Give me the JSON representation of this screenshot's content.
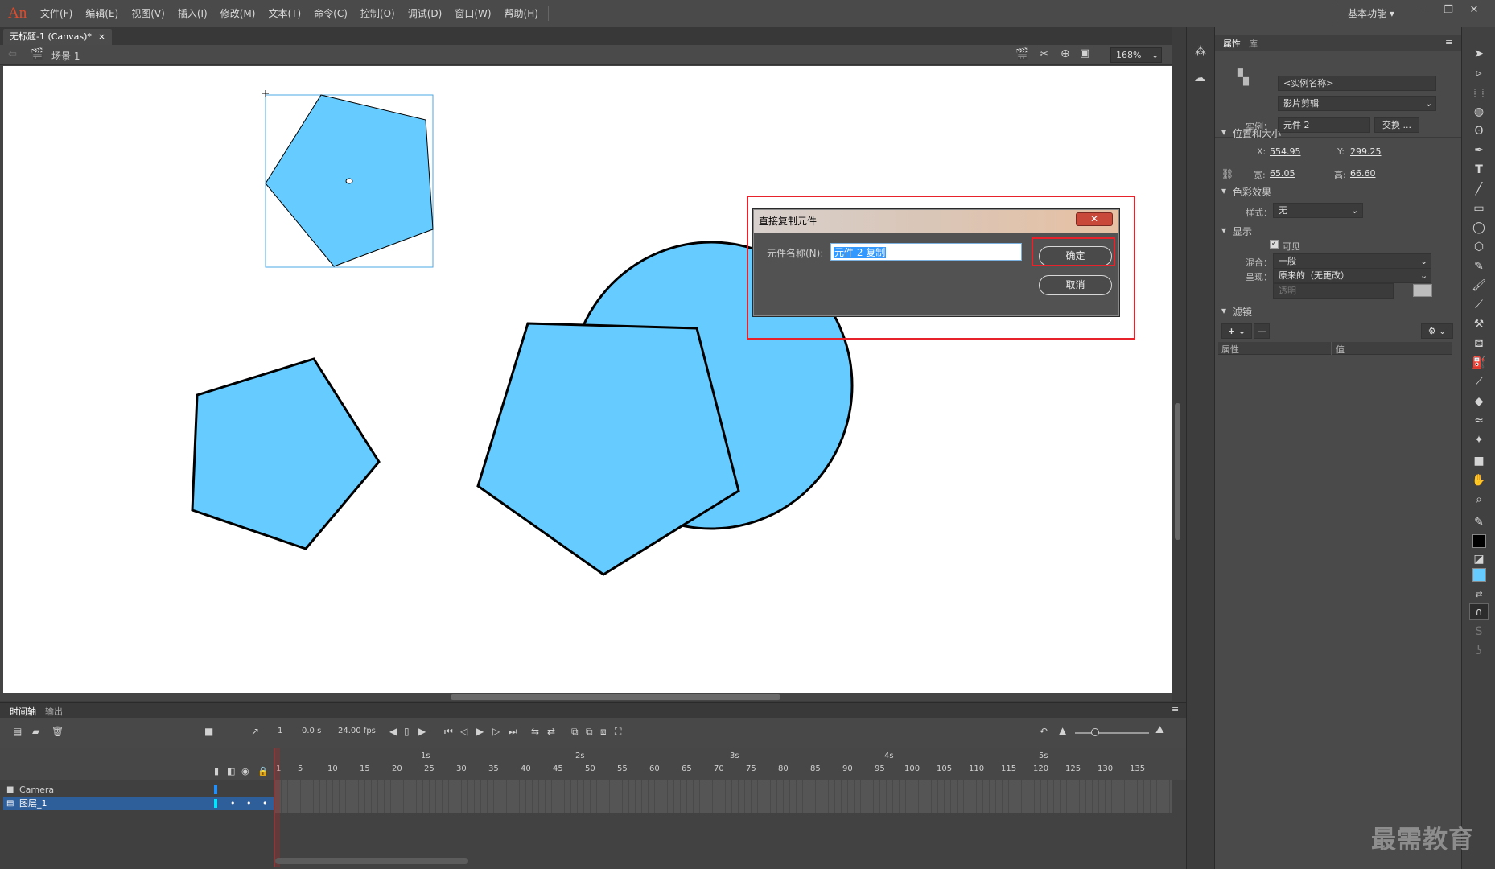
{
  "app": {
    "logo": "An",
    "workspace": "基本功能 ▾"
  },
  "menu": [
    "文件(F)",
    "编辑(E)",
    "视图(V)",
    "插入(I)",
    "修改(M)",
    "文本(T)",
    "命令(C)",
    "控制(O)",
    "调试(D)",
    "窗口(W)",
    "帮助(H)"
  ],
  "window_controls": {
    "minimize": "—",
    "restore": "❐",
    "close": "✕"
  },
  "document": {
    "tab_title": "无标题-1 (Canvas)*",
    "tab_close": "×",
    "scene": "场景 1",
    "zoom": "168%"
  },
  "dialog": {
    "title": "直接复制元件",
    "close": "✕",
    "name_label": "元件名称(N):",
    "name_value": "元件 2 复制",
    "ok_label": "确定",
    "cancel_label": "取消"
  },
  "properties": {
    "tab_properties": "属性",
    "tab_library": "库",
    "instance_name_placeholder": "<实例名称>",
    "symbol_type": "影片剪辑",
    "instance_label": "实例：",
    "instance_value": "元件 2",
    "swap_button": "交换 ...",
    "position_section": "位置和大小",
    "x_label": "X:",
    "x_value": "554.95",
    "y_label": "Y:",
    "y_value": "299.25",
    "w_label": "宽:",
    "w_value": "65.05",
    "h_label": "高:",
    "h_value": "66.60",
    "color_section": "色彩效果",
    "style_label": "样式：",
    "style_value": "无",
    "display_section": "显示",
    "visible_label": "可见",
    "blend_label": "混合：",
    "blend_value": "一般",
    "render_label": "呈现：",
    "render_value": "原来的（无更改）",
    "transparent_value": "透明",
    "filter_section": "滤镜",
    "filter_col_property": "属性",
    "filter_col_value": "值"
  },
  "timeline": {
    "tab_timeline": "时间轴",
    "tab_output": "输出",
    "current_frame": "1",
    "time": "0.0 s",
    "fps": "24.00 fps",
    "seconds": [
      "1s",
      "2s",
      "3s",
      "4s",
      "5s"
    ],
    "frame_numbers": [
      "1",
      "5",
      "10",
      "15",
      "20",
      "25",
      "30",
      "35",
      "40",
      "45",
      "50",
      "55",
      "60",
      "65",
      "70",
      "75",
      "80",
      "85",
      "90",
      "95",
      "100",
      "105",
      "110",
      "115",
      "120",
      "125",
      "130",
      "135"
    ],
    "layers": [
      {
        "name": "Camera",
        "selected": false
      },
      {
        "name": "图层_1",
        "selected": true
      }
    ]
  },
  "watermark": "最需教育",
  "colors": {
    "shape_fill": "#66ccff",
    "highlight_red": "#e8222b",
    "selection_blue": "#3399ff"
  },
  "icons": [
    "selection-tool-icon",
    "subselection-tool-icon",
    "free-transform-icon",
    "lasso-icon",
    "pen-icon",
    "text-icon",
    "line-icon",
    "rectangle-icon",
    "oval-icon",
    "polystar-icon",
    "pencil-icon",
    "brush-icon",
    "paint-brush-icon",
    "bone-icon",
    "paint-bucket-icon",
    "ink-bottle-icon",
    "eyedropper-icon",
    "eraser-icon",
    "width-icon",
    "asset-warp-icon",
    "camera-icon",
    "hand-icon",
    "zoom-icon",
    "stroke-color-icon",
    "fill-color-icon",
    "swap-colors-icon",
    "snap-icon"
  ]
}
